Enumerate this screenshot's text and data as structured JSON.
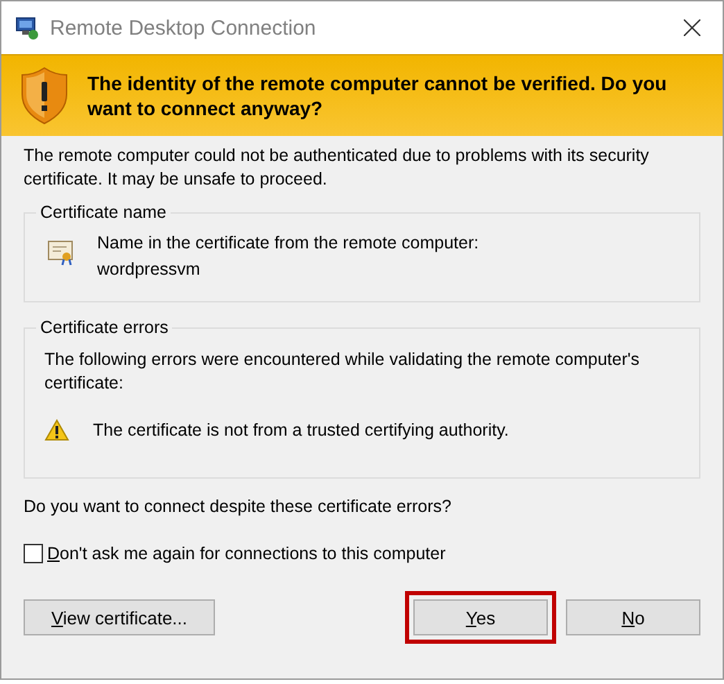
{
  "window": {
    "title": "Remote Desktop Connection"
  },
  "banner": {
    "message": "The identity of the remote computer cannot be verified. Do you want to connect anyway?"
  },
  "intro": "The remote computer could not be authenticated due to problems with its security certificate. It may be unsafe to proceed.",
  "certificate_name": {
    "label": "Certificate name",
    "caption": "Name in the certificate from the remote computer:",
    "value": "wordpressvm"
  },
  "certificate_errors": {
    "label": "Certificate errors",
    "intro": "The following errors were encountered while validating the remote computer's certificate:",
    "errors": [
      "The certificate is not from a trusted certifying authority."
    ]
  },
  "question": "Do you want to connect despite these certificate errors?",
  "dont_ask": {
    "key": "D",
    "rest": "on't ask me again for connections to this computer",
    "checked": false
  },
  "buttons": [
    {
      "key": "V",
      "rest": "iew certificate...",
      "highlighted": false
    },
    {
      "key": "Y",
      "rest": "es",
      "highlighted": true
    },
    {
      "key": "N",
      "rest": "o",
      "highlighted": false
    }
  ]
}
